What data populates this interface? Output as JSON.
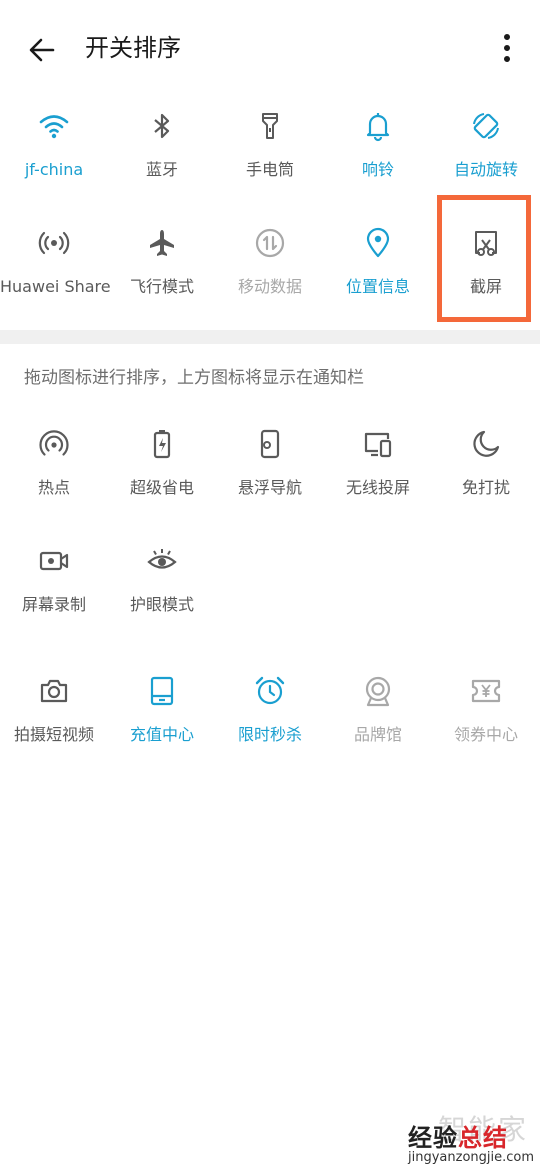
{
  "header": {
    "title": "开关排序",
    "back_icon": "arrow-left-icon",
    "more_icon": "more-vertical-icon"
  },
  "active_tiles": [
    {
      "label": "jf-china",
      "icon": "wifi-icon",
      "state": "on"
    },
    {
      "label": "蓝牙",
      "icon": "bluetooth-icon",
      "state": "off"
    },
    {
      "label": "手电筒",
      "icon": "flashlight-icon",
      "state": "off"
    },
    {
      "label": "响铃",
      "icon": "bell-icon",
      "state": "on"
    },
    {
      "label": "自动旋转",
      "icon": "rotate-icon",
      "state": "on"
    },
    {
      "label": "Huawei Share",
      "icon": "huawei-share-icon",
      "state": "off"
    },
    {
      "label": "飞行模式",
      "icon": "airplane-icon",
      "state": "off"
    },
    {
      "label": "移动数据",
      "icon": "mobile-data-icon",
      "state": "disabled"
    },
    {
      "label": "位置信息",
      "icon": "location-icon",
      "state": "on"
    },
    {
      "label": "截屏",
      "icon": "screenshot-icon",
      "state": "off",
      "highlighted": true
    }
  ],
  "hint": "拖动图标进行排序，上方图标将显示在通知栏",
  "inactive_tiles": [
    {
      "label": "热点",
      "icon": "hotspot-icon",
      "state": "off"
    },
    {
      "label": "超级省电",
      "icon": "battery-saver-icon",
      "state": "off"
    },
    {
      "label": "悬浮导航",
      "icon": "floating-nav-icon",
      "state": "off"
    },
    {
      "label": "无线投屏",
      "icon": "wireless-projection-icon",
      "state": "off"
    },
    {
      "label": "免打扰",
      "icon": "moon-icon",
      "state": "off"
    },
    {
      "label": "屏幕录制",
      "icon": "screen-record-icon",
      "state": "off"
    },
    {
      "label": "护眼模式",
      "icon": "eye-comfort-icon",
      "state": "off"
    }
  ],
  "extra_tiles": [
    {
      "label": "拍摄短视频",
      "icon": "camera-icon",
      "state": "off"
    },
    {
      "label": "充值中心",
      "icon": "recharge-icon",
      "state": "on"
    },
    {
      "label": "限时秒杀",
      "icon": "alarm-clock-icon",
      "state": "on"
    },
    {
      "label": "品牌馆",
      "icon": "badge-icon",
      "state": "disabled"
    },
    {
      "label": "领券中心",
      "icon": "coupon-icon",
      "state": "disabled"
    }
  ],
  "watermark": {
    "faint": "智能家",
    "main_a": "经验",
    "main_b": "总结",
    "url": "jingyanzongjie.com"
  },
  "colors": {
    "accent": "#1a9fd0",
    "icon_gray": "#5a5a5a",
    "disabled": "#a8a8a8",
    "highlight": "#f4683a"
  }
}
